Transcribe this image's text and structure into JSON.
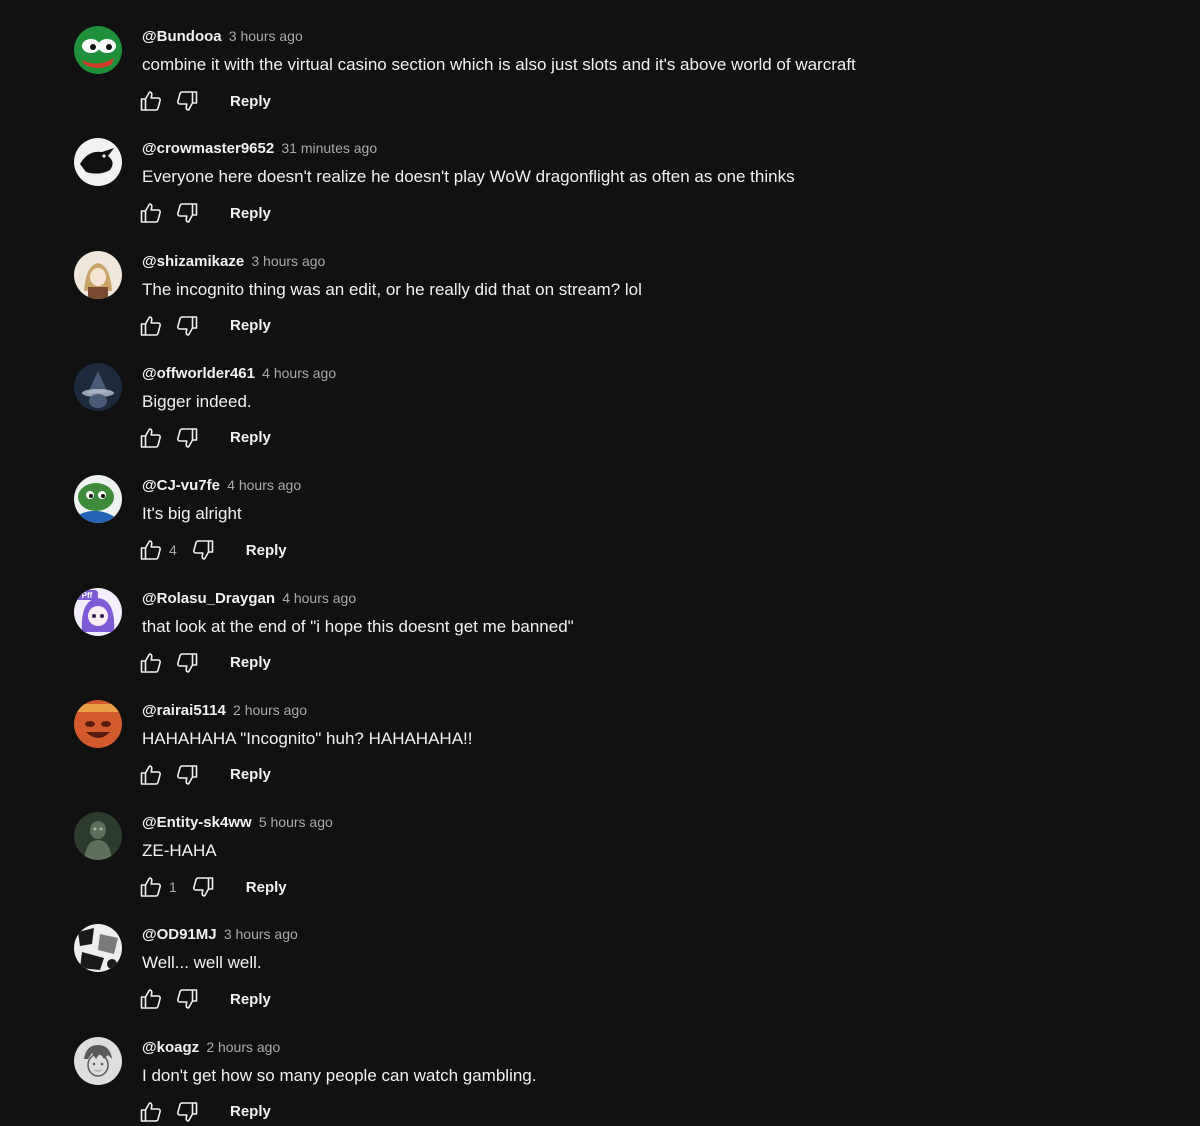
{
  "comments": [
    {
      "author": "@Bundooa",
      "time": "3 hours ago",
      "text": "combine it with the virtual casino section which is also just slots and it's above world of warcraft",
      "likes": "",
      "reply_label": "Reply",
      "avatar": {
        "icon": "frog-avatar-icon",
        "colors": [
          "#1f8f3a",
          "#ffffff",
          "#d23b2a"
        ]
      }
    },
    {
      "author": "@crowmaster9652",
      "time": "31 minutes ago",
      "text": "Everyone here doesn't realize he doesn't play WoW dragonflight as often as one thinks",
      "likes": "",
      "reply_label": "Reply",
      "avatar": {
        "icon": "crow-avatar-icon",
        "colors": [
          "#f2f2f2",
          "#111111"
        ]
      }
    },
    {
      "author": "@shizamikaze",
      "time": "3 hours ago",
      "text": "The incognito thing was an edit, or he really did that on stream? lol",
      "likes": "",
      "reply_label": "Reply",
      "avatar": {
        "icon": "anime-girl-avatar-icon",
        "colors": [
          "#efe7dc",
          "#c9a46a",
          "#7a4a2f"
        ]
      }
    },
    {
      "author": "@offworlder461",
      "time": "4 hours ago",
      "text": "Bigger indeed.",
      "likes": "",
      "reply_label": "Reply",
      "avatar": {
        "icon": "wizard-avatar-icon",
        "colors": [
          "#1d2a3d",
          "#cdd8e8",
          "#4a5b78"
        ]
      }
    },
    {
      "author": "@CJ-vu7fe",
      "time": "4 hours ago",
      "text": "It's big alright",
      "likes": "4",
      "reply_label": "Reply",
      "avatar": {
        "icon": "pepe-avatar-icon",
        "colors": [
          "#3d8a3a",
          "#eef2ee",
          "#2463b8"
        ]
      }
    },
    {
      "author": "@Rolasu_Draygan",
      "time": "4 hours ago",
      "text": "that look at the end of \"i hope this doesnt get me banned\"",
      "likes": "",
      "reply_label": "Reply",
      "avatar": {
        "icon": "purple-anime-avatar-icon",
        "colors": [
          "#7d5bd6",
          "#f3eef9",
          "#2b2450"
        ],
        "badge": "Pff"
      }
    },
    {
      "author": "@rairai5114",
      "time": "2 hours ago",
      "text": "HAHAHAHA \"Incognito\" huh? HAHAHAHA!!",
      "likes": "",
      "reply_label": "Reply",
      "avatar": {
        "icon": "laughing-face-avatar-icon",
        "colors": [
          "#d25a2c",
          "#f0b04a",
          "#5a1c10"
        ]
      }
    },
    {
      "author": "@Entity-sk4ww",
      "time": "5 hours ago",
      "text": "ZE-HAHA",
      "likes": "1",
      "reply_label": "Reply",
      "avatar": {
        "icon": "dark-figure-avatar-icon",
        "colors": [
          "#2d3a2e",
          "#5e6f5c",
          "#a9b5a6"
        ]
      }
    },
    {
      "author": "@OD91MJ",
      "time": "3 hours ago",
      "text": "Well... well well.",
      "likes": "",
      "reply_label": "Reply",
      "avatar": {
        "icon": "manga-panel-avatar-icon",
        "colors": [
          "#eeeeee",
          "#1a1a1a",
          "#7a7a7a"
        ]
      }
    },
    {
      "author": "@koagz",
      "time": "2 hours ago",
      "text": "I don't get how so many people can watch gambling.",
      "likes": "",
      "reply_label": "Reply",
      "avatar": {
        "icon": "sketch-character-avatar-icon",
        "colors": [
          "#dedede",
          "#5a5a5a",
          "#a0a0a0"
        ]
      }
    }
  ]
}
